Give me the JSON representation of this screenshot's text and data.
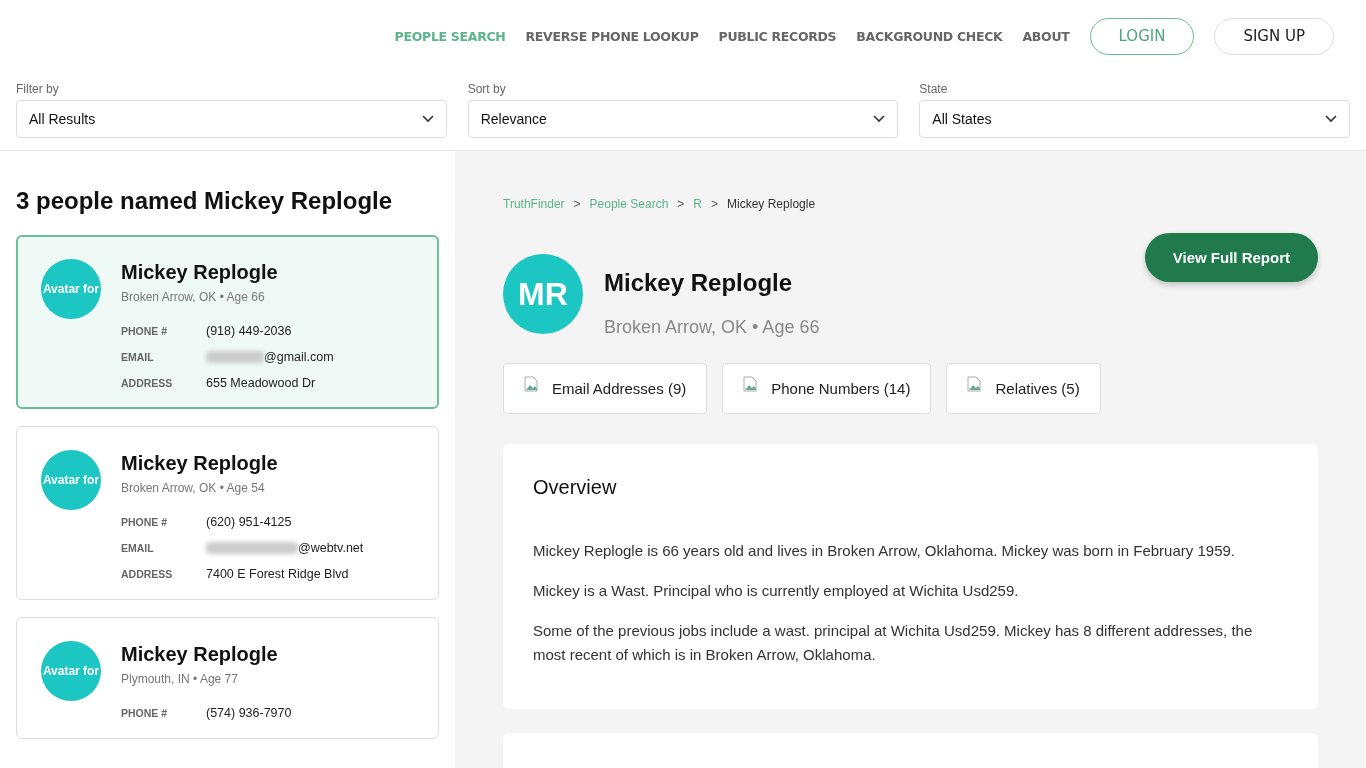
{
  "nav": {
    "items": [
      {
        "label": "PEOPLE SEARCH",
        "selected": true
      },
      {
        "label": "REVERSE PHONE LOOKUP",
        "selected": false
      },
      {
        "label": "PUBLIC RECORDS",
        "selected": false
      },
      {
        "label": "BACKGROUND CHECK",
        "selected": false
      },
      {
        "label": "ABOUT",
        "selected": false
      }
    ],
    "login": "LOGIN",
    "signup": "SIGN UP"
  },
  "filters": [
    {
      "label": "Filter by",
      "value": "All Results"
    },
    {
      "label": "Sort by",
      "value": "Relevance"
    },
    {
      "label": "State",
      "value": "All States"
    }
  ],
  "results_title": "3 people named Mickey Replogle",
  "results": [
    {
      "avatar_alt": "Avatar for",
      "name": "Mickey Replogle",
      "subtitle": "Broken Arrow, OK • Age 66",
      "selected": true,
      "fields": [
        {
          "label": "PHONE #",
          "value": "(918) 449-2036",
          "redacted": false
        },
        {
          "label": "EMAIL",
          "value": "@gmail.com",
          "redacted": true
        },
        {
          "label": "ADDRESS",
          "value": "655 Meadowood Dr",
          "redacted": false
        }
      ]
    },
    {
      "avatar_alt": "Avatar for",
      "name": "Mickey Replogle",
      "subtitle": "Broken Arrow, OK • Age 54",
      "selected": false,
      "fields": [
        {
          "label": "PHONE #",
          "value": "(620) 951-4125",
          "redacted": false
        },
        {
          "label": "EMAIL",
          "value": "@webtv.net",
          "redacted": true
        },
        {
          "label": "ADDRESS",
          "value": "7400 E Forest Ridge Blvd",
          "redacted": false
        }
      ]
    },
    {
      "avatar_alt": "Avatar for",
      "name": "Mickey Replogle",
      "subtitle": "Plymouth, IN • Age 77",
      "selected": false,
      "fields": [
        {
          "label": "PHONE #",
          "value": "(574) 936-7970",
          "redacted": false
        }
      ]
    }
  ],
  "breadcrumb_separator": ">",
  "breadcrumb": [
    {
      "label": "TruthFinder",
      "kind": "link"
    },
    {
      "label": "People Search",
      "kind": "link"
    },
    {
      "label": "R",
      "kind": "link"
    },
    {
      "label": "Mickey Replogle",
      "kind": "current"
    }
  ],
  "profile": {
    "initials": "MR",
    "name": "Mickey Replogle",
    "subtitle": "Broken Arrow, OK • Age 66",
    "report_button": "View Full Report",
    "chips": [
      "Email Addresses (9)",
      "Phone Numbers (14)",
      "Relatives (5)"
    ]
  },
  "overview": {
    "title": "Overview",
    "paragraphs": [
      "Mickey Replogle is 66 years old and lives in Broken Arrow, Oklahoma. Mickey was born in February 1959.",
      "Mickey is a Wast. Principal who is currently employed at Wichita Usd259.",
      "Some of the previous jobs include a wast. principal at Wichita Usd259. Mickey has 8 different addresses, the most recent of which is in Broken Arrow, Oklahoma."
    ]
  }
}
